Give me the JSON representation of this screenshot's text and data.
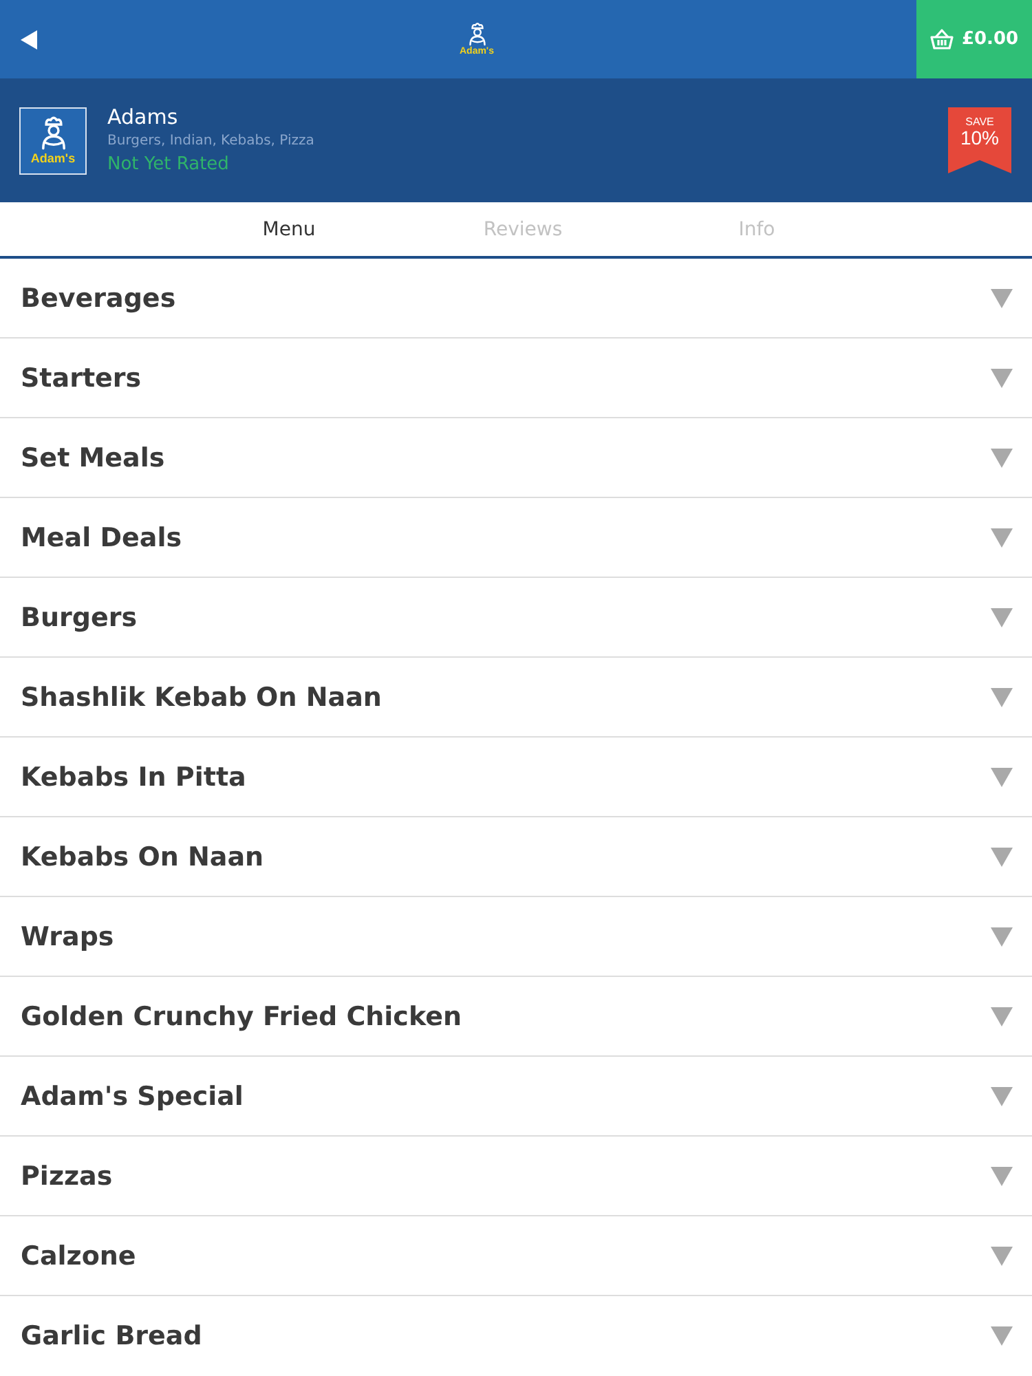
{
  "top_bar": {
    "logo_text": "Adam's",
    "cart": {
      "total": "£0.00"
    }
  },
  "restaurant": {
    "name": "Adams",
    "logo_text": "Adam's",
    "cuisines": "Burgers, Indian, Kebabs, Pizza",
    "rating": "Not Yet Rated",
    "discount": {
      "label": "SAVE",
      "value": "10%"
    }
  },
  "tabs": [
    {
      "label": "Menu",
      "selected": true
    },
    {
      "label": "Reviews",
      "selected": false
    },
    {
      "label": "Info",
      "selected": false
    }
  ],
  "categories": [
    {
      "name": "Beverages",
      "expanded": false
    },
    {
      "name": "Starters",
      "expanded": false
    },
    {
      "name": "Set Meals",
      "expanded": false
    },
    {
      "name": "Meal Deals",
      "expanded": false
    },
    {
      "name": "Burgers",
      "expanded": false
    },
    {
      "name": "Shashlik Kebab On Naan",
      "expanded": false
    },
    {
      "name": "Kebabs In Pitta",
      "expanded": false
    },
    {
      "name": "Kebabs On Naan",
      "expanded": false
    },
    {
      "name": "Wraps",
      "expanded": false
    },
    {
      "name": "Golden Crunchy Fried Chicken",
      "expanded": false
    },
    {
      "name": "Adam's Special",
      "expanded": false
    },
    {
      "name": "Pizzas",
      "expanded": false
    },
    {
      "name": "Calzone",
      "expanded": false
    },
    {
      "name": "Garlic Bread",
      "expanded": false
    }
  ]
}
